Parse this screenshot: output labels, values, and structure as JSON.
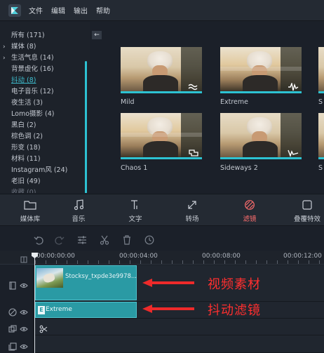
{
  "menu": {
    "items": [
      "文件",
      "编辑",
      "输出",
      "帮助"
    ]
  },
  "categories": [
    {
      "label": "所有 (171)",
      "expandable": false
    },
    {
      "label": "媒体 (8)",
      "expandable": true
    },
    {
      "label": "生活气息 (14)",
      "expandable": true
    },
    {
      "label": "背景虚化 (16)",
      "expandable": false
    },
    {
      "label": "抖动 (8)",
      "expandable": false,
      "active": true
    },
    {
      "label": "电子音乐 (12)",
      "expandable": false
    },
    {
      "label": "夜生活 (3)",
      "expandable": false
    },
    {
      "label": "Lomo摄影 (4)",
      "expandable": false
    },
    {
      "label": "黑白 (2)",
      "expandable": false
    },
    {
      "label": "棕色调 (2)",
      "expandable": false
    },
    {
      "label": "形变 (18)",
      "expandable": false
    },
    {
      "label": "材料 (11)",
      "expandable": false
    },
    {
      "label": "Instagram风 (24)",
      "expandable": false
    },
    {
      "label": "老旧 (49)",
      "expandable": false
    },
    {
      "label": "收藏 (0)",
      "expandable": false
    }
  ],
  "collapse_glyph": "←",
  "effects": [
    {
      "name": "Mild",
      "icon": "wave-icon"
    },
    {
      "name": "Extreme",
      "icon": "pulse-icon"
    },
    {
      "name": "Chaos 1",
      "icon": "jagged-box-icon"
    },
    {
      "name": "Sideways 2",
      "icon": "sideways-wave-icon"
    }
  ],
  "partial_labels": [
    "S",
    "S"
  ],
  "tabs": [
    {
      "label": "媒体库",
      "icon": "folder-icon"
    },
    {
      "label": "音乐",
      "icon": "music-note-icon"
    },
    {
      "label": "文字",
      "icon": "text-icon"
    },
    {
      "label": "转场",
      "icon": "transition-icon"
    },
    {
      "label": "滤镜",
      "icon": "filter-icon",
      "active": true
    },
    {
      "label": "叠覆特效",
      "icon": "overlay-icon"
    }
  ],
  "timeline": {
    "times": [
      "00:00:00:00",
      "00:00:04:00",
      "00:00:08:00",
      "00:00:12:00"
    ],
    "video_clip_title": "Stocksy_txpde3e9978...",
    "fx_clip_name": "Extreme"
  },
  "annotations": {
    "video": "视频素材",
    "filter": "抖动滤镜"
  },
  "colors": {
    "accent": "#2dc2d2",
    "active_tab": "#ff6e6e",
    "annotation": "#ee2a2a"
  }
}
